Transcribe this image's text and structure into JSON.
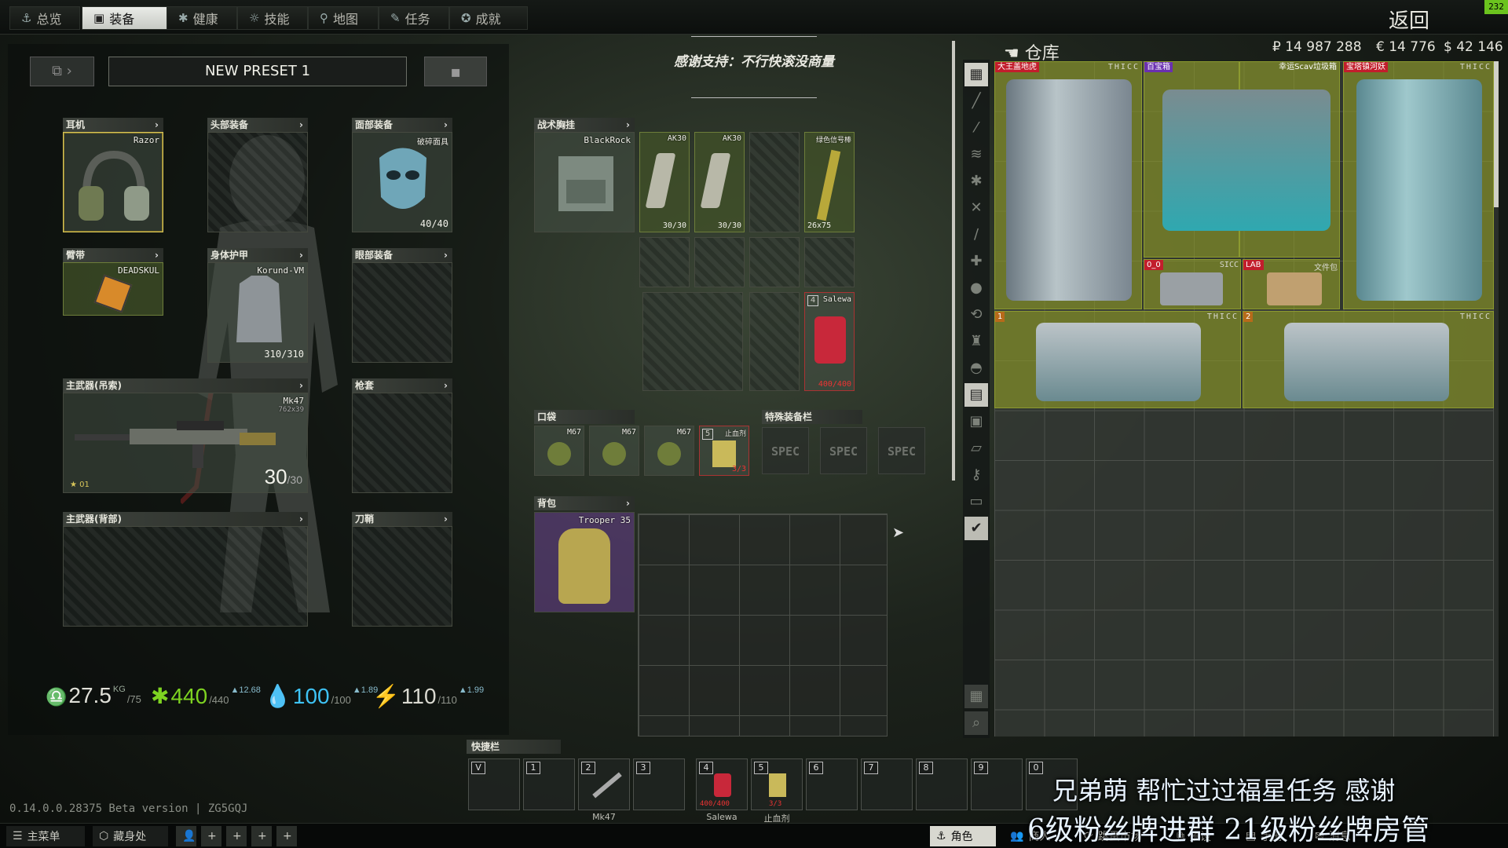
{
  "nav": {
    "tabs": [
      {
        "label": "总览",
        "icon": "anchor-icon"
      },
      {
        "label": "装备",
        "icon": "vest-icon",
        "active": true
      },
      {
        "label": "健康",
        "icon": "health-icon"
      },
      {
        "label": "技能",
        "icon": "skills-icon"
      },
      {
        "label": "地图",
        "icon": "map-pin-icon"
      },
      {
        "label": "任务",
        "icon": "task-icon"
      },
      {
        "label": "成就",
        "icon": "achievement-icon"
      }
    ],
    "back_label": "返回",
    "fps": "232"
  },
  "preset": {
    "name": "NEW PRESET 1"
  },
  "banner": {
    "text": "感谢支持：不行快滚没商量"
  },
  "equipment": {
    "earpiece": {
      "header": "耳机",
      "item": "Razor"
    },
    "headwear": {
      "header": "头部装备"
    },
    "face_cover": {
      "header": "面部装备",
      "item": "破碎面具",
      "durability": "40/40"
    },
    "armband": {
      "header": "臂带",
      "item": "DEADSKUL"
    },
    "body_armor": {
      "header": "身体护甲",
      "item": "Korund-VM",
      "durability": "310/310"
    },
    "eyewear": {
      "header": "眼部装备"
    },
    "primary_sling": {
      "header": "主武器(吊索)",
      "item": "Mk47",
      "caliber": "762x39",
      "ammo": "30",
      "ammo_max": "/30",
      "level": "01"
    },
    "holster": {
      "header": "枪套"
    },
    "primary_back": {
      "header": "主武器(背部)"
    },
    "scabbard": {
      "header": "刀鞘"
    }
  },
  "rig": {
    "header": "战术胸挂",
    "item": "BlackRock",
    "slots": [
      {
        "name": "AK30",
        "count": "30/30"
      },
      {
        "name": "AK30",
        "count": "30/30"
      },
      {
        "name": ""
      },
      {
        "name": "绿色信号棒",
        "count": "26x75"
      }
    ],
    "salewa": {
      "name": "Salewa",
      "badge": "4",
      "count": "400/400"
    }
  },
  "pockets": {
    "header": "口袋",
    "items": [
      {
        "name": "M67"
      },
      {
        "name": "M67"
      },
      {
        "name": "M67"
      },
      {
        "name": "止血剂",
        "badge": "5",
        "count": "3/3"
      }
    ]
  },
  "special": {
    "header": "特殊装备栏",
    "slots": [
      "SPEC",
      "SPEC",
      "SPEC"
    ]
  },
  "backpack": {
    "header": "背包",
    "item": "Trooper 35"
  },
  "stats": {
    "weight": {
      "value": "27.5",
      "unit": "KG",
      "max": "/75"
    },
    "health": {
      "value": "440",
      "max": "/440",
      "rate": "▲12.68"
    },
    "hydration": {
      "value": "100",
      "max": "/100",
      "rate": "▲1.89"
    },
    "energy": {
      "value": "110",
      "max": "/110",
      "rate": "▲1.99"
    }
  },
  "stash": {
    "title": "仓库",
    "currency": {
      "rub": "₽ 14 987 288",
      "eur": "€ 14 776",
      "usd": "$ 42 146"
    },
    "items": [
      {
        "label": "大王盖地虎",
        "tag": "THICC",
        "tag_color": "#c21d2c"
      },
      {
        "label": "百宝箱",
        "tag_color": "#6a2fb0"
      },
      {
        "label": "幸运Scav垃圾箱"
      },
      {
        "label": "宝塔镇河妖",
        "tag": "THICC",
        "tag_color": "#c21d2c"
      },
      {
        "label": "0_0",
        "sub": "SICC",
        "tag_color": "#c21d2c"
      },
      {
        "label": "LAB",
        "tag_color": "#c21d2c"
      },
      {
        "label": "文件包"
      },
      {
        "label": "1",
        "tag": "THICC",
        "tag_color": "#b76a1a"
      },
      {
        "label": "2",
        "tag": "THICC",
        "tag_color": "#b76a1a"
      }
    ]
  },
  "quickbar": {
    "header": "快捷栏",
    "slots": [
      {
        "key": "V"
      },
      {
        "key": "1"
      },
      {
        "key": "2",
        "name": "Mk47"
      },
      {
        "key": "3"
      },
      {
        "key": "4",
        "name": "Salewa",
        "count": "400/400"
      },
      {
        "key": "5",
        "name": "止血剂",
        "count": "3/3"
      },
      {
        "key": "6"
      },
      {
        "key": "7"
      },
      {
        "key": "8"
      },
      {
        "key": "9"
      },
      {
        "key": "0"
      }
    ]
  },
  "version": "0.14.0.0.28375 Beta version | ZG5GQJ",
  "bottom": {
    "left": [
      "主菜单",
      "藏身处"
    ],
    "right": [
      "角色",
      "商人",
      "跳蚤市场",
      "预设",
      "手册",
      "消息"
    ]
  },
  "overlay": {
    "line1": "兄弟萌 帮忙过过福星任务 感谢",
    "line2": "6级粉丝牌进群  21级粉丝牌房管"
  },
  "colors": {
    "accent": "#6bc31e",
    "health": "#7ed321",
    "hydration": "#3ec3f5",
    "energy": "#d9d9d0"
  }
}
